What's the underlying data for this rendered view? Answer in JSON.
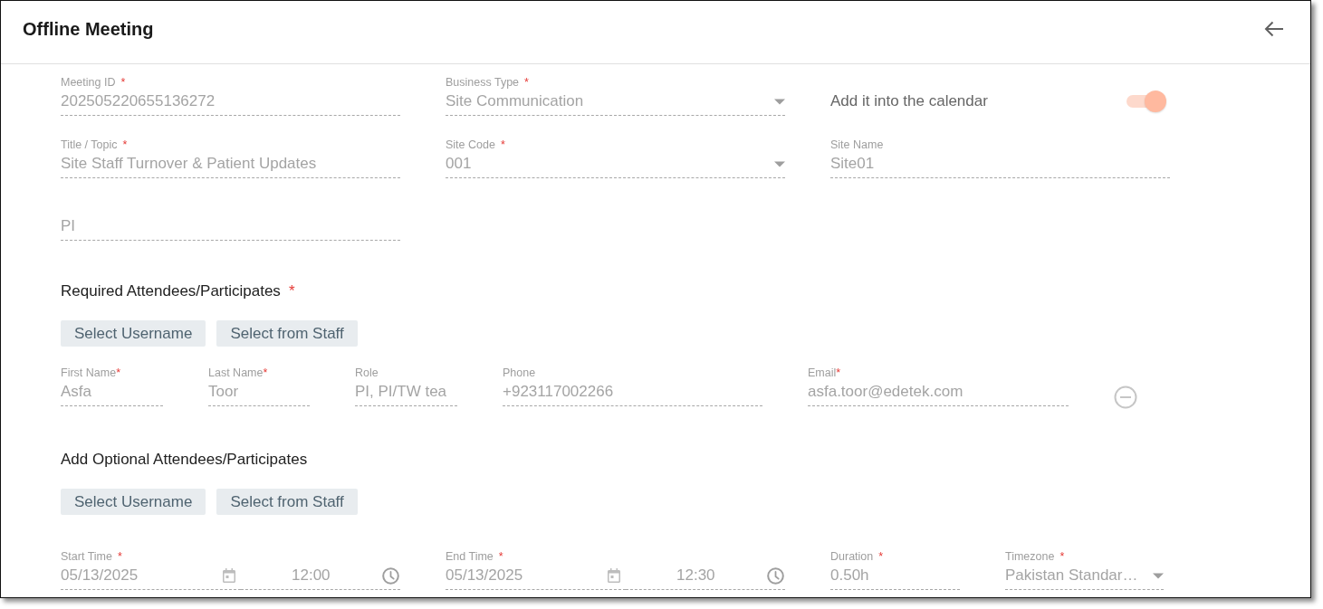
{
  "window": {
    "title": "Offline Meeting"
  },
  "general_fields": [
    {
      "kind": "text",
      "label": "Meeting ID",
      "marker": "*",
      "value": "202505220655136272",
      "disabled": true
    },
    {
      "kind": "select",
      "label": "Business Type",
      "marker": "*",
      "value": "Site Communication",
      "disabled": true
    },
    {
      "kind": "toggle",
      "label": "Add it into the calendar",
      "on": true,
      "disabled": true
    },
    {
      "kind": "text",
      "label": "Title / Topic",
      "marker": "*",
      "value": "Site Staff Turnover & Patient Updates",
      "disabled": true
    },
    {
      "kind": "select",
      "label": "Site Code",
      "marker": "*",
      "value": "001",
      "disabled": true
    },
    {
      "kind": "text",
      "label": "Site Name",
      "value": "Site01",
      "disabled": true
    },
    {
      "kind": "text",
      "placeholder": "PI",
      "disabled": true
    }
  ],
  "required_attendees": {
    "title": "Required Attendees/Participates",
    "marker": "*",
    "buttons": [
      "Select Username",
      "Select from Staff"
    ],
    "attendees": [
      {
        "fields": [
          {
            "label": "First Name",
            "marker": "*",
            "value": "Asfa",
            "disabled": true
          },
          {
            "label": "Last Name",
            "marker": "*",
            "value": "Toor",
            "disabled": true
          },
          {
            "label": "Role",
            "value": "PI, PI/TW tea",
            "disabled": true
          },
          {
            "label": "Phone",
            "value": "+923117002266",
            "disabled": true
          },
          {
            "label": "Email",
            "marker": "*",
            "value": "asfa.toor@edetek.com",
            "disabled": true
          }
        ]
      }
    ]
  },
  "optional_attendees": {
    "title": "Add Optional Attendees/Participates",
    "buttons": [
      "Select Username",
      "Select from Staff"
    ]
  },
  "schedule": [
    {
      "kind": "datetime",
      "label": "Start Time",
      "marker": "*",
      "date": "05/13/2025",
      "time": "12:00",
      "disabled": true
    },
    {
      "kind": "datetime",
      "label": "End Time",
      "marker": "*",
      "date": "05/13/2025",
      "time": "12:30",
      "disabled": true
    },
    {
      "kind": "text",
      "label": "Duration",
      "marker": "*",
      "value": "0.50h",
      "disabled": true
    },
    {
      "kind": "select",
      "label": "Timezone",
      "marker": "*",
      "value": "Pakistan Standar…",
      "disabled": true
    }
  ]
}
